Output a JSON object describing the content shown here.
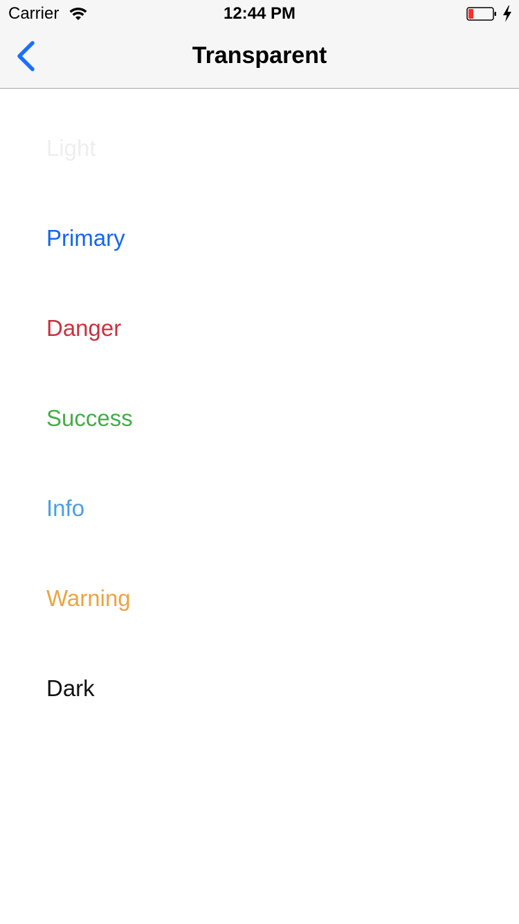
{
  "status_bar": {
    "carrier": "Carrier",
    "time": "12:44 PM",
    "battery_color": "#ff2d2d"
  },
  "nav_bar": {
    "title": "Transparent",
    "back_icon": "chevron-left-icon",
    "accent_color": "#1a6fff"
  },
  "items": [
    {
      "label": "Light",
      "color": "#eeeeee"
    },
    {
      "label": "Primary",
      "color": "#1565f2"
    },
    {
      "label": "Danger",
      "color": "#c9323f"
    },
    {
      "label": "Success",
      "color": "#41ad49"
    },
    {
      "label": "Info",
      "color": "#4a9ee6"
    },
    {
      "label": "Warning",
      "color": "#eba443"
    },
    {
      "label": "Dark",
      "color": "#111111"
    }
  ]
}
